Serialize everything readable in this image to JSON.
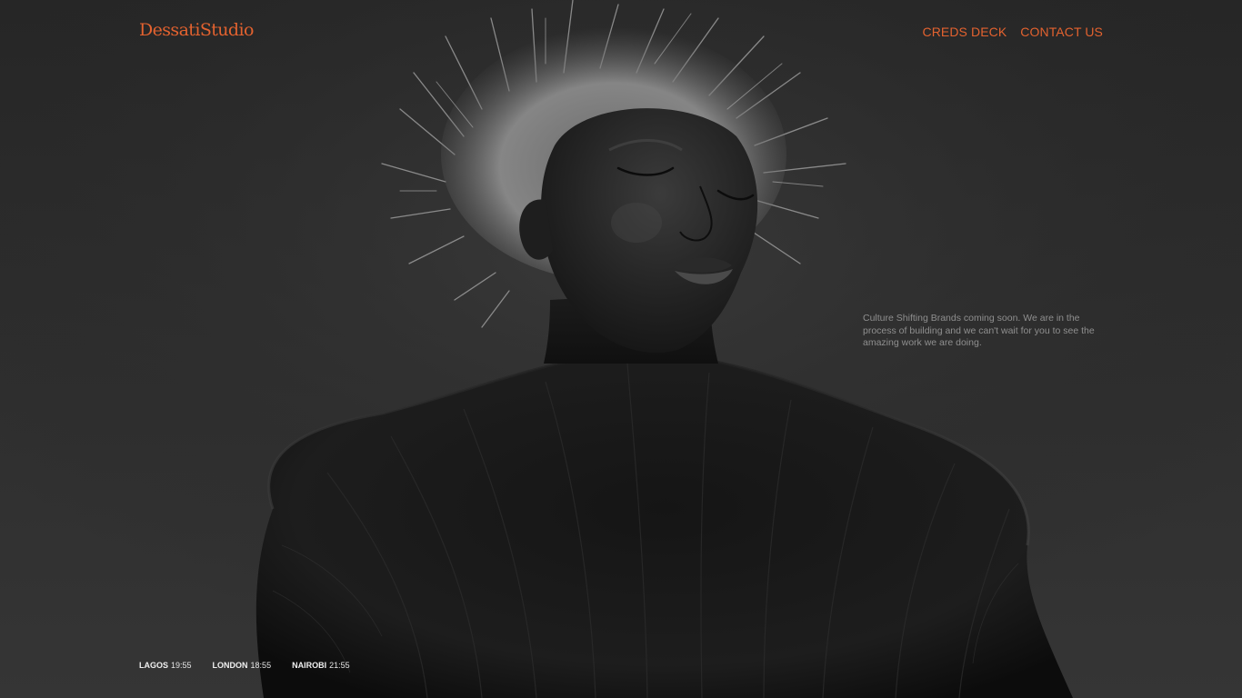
{
  "brand": {
    "logo_text": "DessatiStudio",
    "accent_color": "#e3622f"
  },
  "nav": {
    "items": [
      {
        "label": "CREDS DECK"
      },
      {
        "label": "CONTACT US"
      }
    ]
  },
  "hero": {
    "tagline": "Culture Shifting Brands coming soon. We are in the process of building and we can't wait for you to see the amazing work we are doing."
  },
  "clocks": [
    {
      "city": "LAGOS",
      "time": "19:55"
    },
    {
      "city": "LONDON",
      "time": "18:55"
    },
    {
      "city": "NAIROBI",
      "time": "21:55"
    }
  ]
}
